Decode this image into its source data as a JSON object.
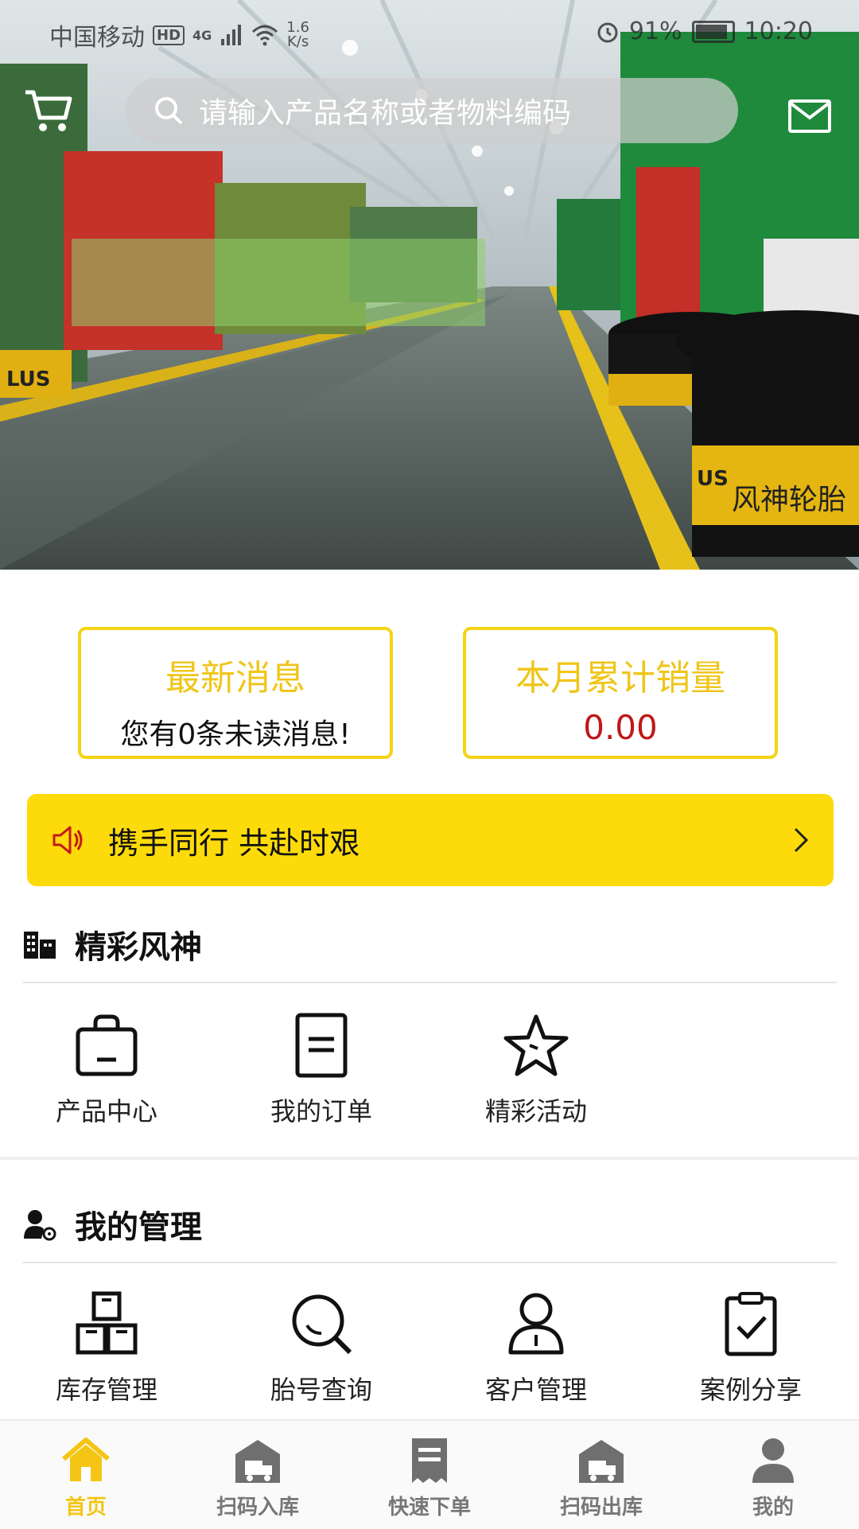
{
  "status_bar": {
    "carrier": "中国移动",
    "hd": "HD",
    "network": "4G",
    "speed_value": "1.6",
    "speed_unit": "K/s",
    "battery": "91%",
    "battery_level": 0.91,
    "time": "10:20"
  },
  "header": {
    "search_placeholder": "请输入产品名称或者物料编码",
    "cart_icon": "cart-icon",
    "mail_icon": "mail-icon"
  },
  "banner": {
    "tire_text": "风神轮胎",
    "tire_brand_fragment": "US",
    "side_text": "LUS"
  },
  "stats": {
    "messages": {
      "title": "最新消息",
      "text": "您有0条未读消息!"
    },
    "sales": {
      "title": "本月累计销量",
      "value": "0.00"
    }
  },
  "notice": {
    "text": "携手同行 共赴时艰",
    "icon": "speaker-icon"
  },
  "section_featured": {
    "title": "精彩风神",
    "items": [
      {
        "label": "产品中心",
        "icon": "bag-icon"
      },
      {
        "label": "我的订单",
        "icon": "document-icon"
      },
      {
        "label": "精彩活动",
        "icon": "star-icon"
      }
    ]
  },
  "section_manage": {
    "title": "我的管理",
    "items": [
      {
        "label": "库存管理",
        "icon": "boxes-icon"
      },
      {
        "label": "胎号查询",
        "icon": "search-icon"
      },
      {
        "label": "客户管理",
        "icon": "person-icon"
      },
      {
        "label": "案例分享",
        "icon": "clipboard-check-icon"
      }
    ]
  },
  "tabbar": {
    "items": [
      {
        "label": "首页",
        "icon": "home-icon",
        "active": true
      },
      {
        "label": "扫码入库",
        "icon": "warehouse-truck-icon",
        "active": false
      },
      {
        "label": "快速下单",
        "icon": "receipt-icon",
        "active": false
      },
      {
        "label": "扫码出库",
        "icon": "warehouse-truck-icon",
        "active": false
      },
      {
        "label": "我的",
        "icon": "user-icon",
        "active": false
      }
    ]
  },
  "colors": {
    "accent_yellow": "#fddb0a",
    "title_yellow": "#f0c51a",
    "value_red": "#c01818",
    "tab_active": "#f4c514"
  }
}
